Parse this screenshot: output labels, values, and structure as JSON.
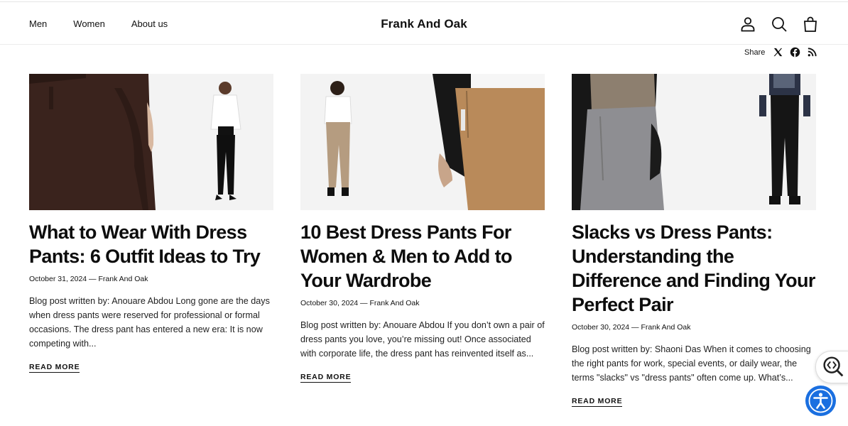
{
  "header": {
    "nav": [
      "Men",
      "Women",
      "About us"
    ],
    "logo": "Frank And Oak",
    "icons": [
      "account-icon",
      "search-icon",
      "bag-icon"
    ]
  },
  "share": {
    "label": "Share",
    "icons": [
      "x-icon",
      "facebook-icon",
      "rss-icon"
    ]
  },
  "posts": [
    {
      "title": "What to Wear With Dress Pants: 6 Outfit Ideas to Try",
      "meta": "October 31, 2024 — Frank And Oak",
      "excerpt": "Blog post written by: Anouare Abdou Long gone are the days when dress pants were reserved for professional or formal occasions. The dress pant has entered a new era: It is now competing with...",
      "read_more": "READ MORE"
    },
    {
      "title": "10 Best Dress Pants For Women & Men to Add to Your Wardrobe",
      "meta": "October 30, 2024 — Frank And Oak",
      "excerpt": "Blog post written by: Anouare Abdou If you don’t own a pair of dress pants you love, you’re missing out! Once associated with corporate life, the dress pant has reinvented itself as...",
      "read_more": "READ MORE"
    },
    {
      "title": "Slacks vs Dress Pants: Understanding the Difference and Finding Your Perfect Pair",
      "meta": "October 30, 2024 — Frank And Oak",
      "excerpt": "Blog post written by: Shaoni Das When it comes to choosing the right pants for work, special events, or daily wear, the terms \"slacks\" vs \"dress pants\" often come up. What’s...",
      "read_more": "READ MORE"
    }
  ],
  "widgets": {
    "reader_icon": "reader-view-icon",
    "accessibility_icon": "accessibility-icon",
    "accessibility_color": "#1a6fe0"
  }
}
